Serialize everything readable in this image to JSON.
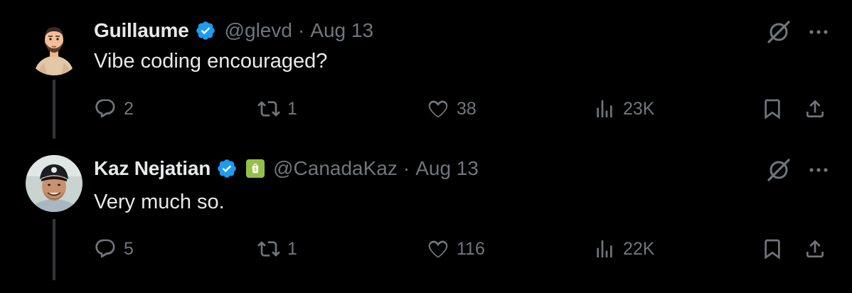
{
  "tweets": [
    {
      "display_name": "Guillaume",
      "handle": "@glevd",
      "separator": "·",
      "date": "Aug 13",
      "verified": true,
      "affiliate_badge": null,
      "text": "Vibe coding encouraged?",
      "replies": "2",
      "reposts": "1",
      "likes": "38",
      "views": "23K",
      "avatar": "cartoon-man-avatar"
    },
    {
      "display_name": "Kaz Nejatian",
      "handle": "@CanadaKaz",
      "separator": "·",
      "date": "Aug 13",
      "verified": true,
      "affiliate_badge": "shopify-icon",
      "text": "Very much so.",
      "replies": "5",
      "reposts": "1",
      "likes": "116",
      "views": "22K",
      "avatar": "man-in-cap-photo"
    }
  ],
  "colors": {
    "background": "#000000",
    "primary_text": "#e7e9ea",
    "secondary_text": "#71767b",
    "verified_blue": "#1d9bf0",
    "thread_line": "#333639",
    "shopify_green": "#95bf47"
  },
  "icons": {
    "reply": "reply-icon",
    "repost": "repost-icon",
    "like": "like-icon",
    "views": "views-icon",
    "bookmark": "bookmark-icon",
    "share": "share-icon",
    "grok": "grok-icon",
    "more": "more-icon"
  }
}
